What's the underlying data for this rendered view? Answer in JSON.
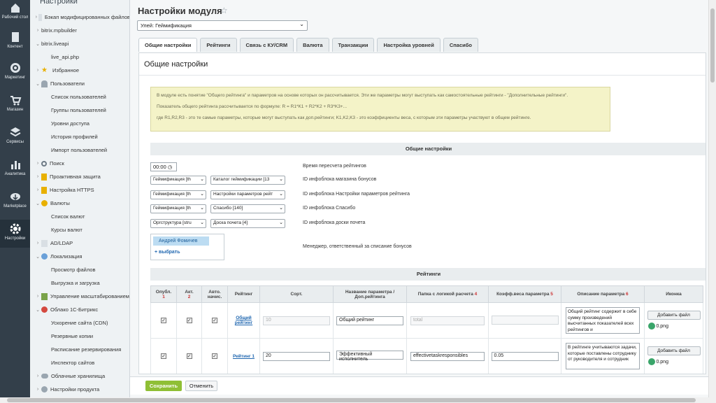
{
  "rail": [
    {
      "label": "Рабочий стол",
      "icon": "house-icon"
    },
    {
      "label": "Контент",
      "icon": "document-icon"
    },
    {
      "label": "Маркетинг",
      "icon": "target-icon"
    },
    {
      "label": "Магазин",
      "icon": "cart-icon"
    },
    {
      "label": "Сервисы",
      "icon": "layers-icon"
    },
    {
      "label": "Аналитика",
      "icon": "bar-chart-icon"
    },
    {
      "label": "Marketplace",
      "icon": "cloud-download-icon"
    },
    {
      "label": "Настройки",
      "icon": "gear-icon"
    }
  ],
  "tree": {
    "header": "Настройки",
    "items": [
      "Бэкап модифицированных файлов",
      "bitrix.mpbuilder",
      "bitrix.liveapi",
      "live_api.php",
      "Избранное",
      "Пользователи",
      "Список пользователей",
      "Группы пользователей",
      "Уровни доступа",
      "История профилей",
      "Импорт пользователей",
      "Поиск",
      "Проактивная защита",
      "Настройка HTTPS",
      "Валюты",
      "Список валют",
      "Курсы валют",
      "AD/LDAP",
      "Локализация",
      "Просмотр файлов",
      "Выгрузка и загрузка",
      "Управление масштабированием",
      "Облако 1С-Битрикс",
      "Ускорение сайта (CDN)",
      "Резервные копии",
      "Расписание резервирования",
      "Инспектор сайтов",
      "Облачные хранилища",
      "Настройки продукта"
    ]
  },
  "page": {
    "title": "Настройки модуля",
    "module_select": "Улей: Геймификация"
  },
  "tabs": [
    "Общие настройки",
    "Рейтинги",
    "Связь с КУ/CRM",
    "Валюта",
    "Транзакции",
    "Настройка уровней",
    "Спасибо"
  ],
  "panel": {
    "title": "Общие настройки"
  },
  "notice": [
    "В модуле есть понятие \"Общего рейтинга\" и параметров на основе которых он рассчитывается. Эти же параметры могут выступать как самостоятельные рейтинги - \"Дополнительные рейтинги\".",
    "Показатель общего рейтинга рассчитывается по формуле: R = R1*K1 + R2*K2 + R3*K3+...",
    "где R1,R2,R3 - это те самые параметры, которые могут выступать как доп.рейтинги; K1,K2,K3 - это коэффициенты веса, с которым эти параметры участвуют в общем рейтинге."
  ],
  "general": {
    "section": "Общие настройки",
    "time": "00:00",
    "time_label": "Время пересчета рейтингов",
    "rows": [
      {
        "left": "Геймификация [th",
        "right": "Каталог геймификации [13",
        "label": "ID инфоблока магазина бонусов"
      },
      {
        "left": "Геймификация [th",
        "right": "Настройки параметров рейт",
        "label": "ID инфоблока Настройки параметров рейтинга"
      },
      {
        "left": "Геймификация [th",
        "right": "Спасибо [140]",
        "label": "ID инфоблока Спасибо"
      },
      {
        "left": "Оргструктура [stru",
        "right": "Доска почета [4]",
        "label": "ID инфоблока доски почета"
      }
    ],
    "manager_chip": "Андрей Фомичев",
    "manager_pick": "+ выбрать",
    "manager_label": "Менеджер, ответственный за списание бонусов"
  },
  "ratings": {
    "section": "Рейтинги",
    "headers": [
      "Опубл.",
      "Акт.",
      "Авто. начис.",
      "Рейтинг",
      "Сорт.",
      "Название параметра / Доп.рейтинга",
      "Папка с логикой расчета",
      "Коэфф.веса параметра",
      "Описание параметра",
      "Иконка"
    ],
    "header_marks": [
      "1",
      "2",
      "",
      "",
      "",
      "",
      "4",
      "5",
      "6",
      ""
    ],
    "add_file": "Добавить файл",
    "rows": [
      {
        "link": "Общий рейтинг",
        "sort": "10",
        "name": "Общий рейтинг",
        "folder": "total",
        "coef": "",
        "desc": "Общий рейтинг содержит в себе сумму произведений высчитанных показателей всех рейтингов и",
        "file": "0.png"
      },
      {
        "link": "Рейтинг 1",
        "sort": "20",
        "name": "Эффективный исполнитель",
        "folder": "effectivetaskresponsibles",
        "coef": "0.05",
        "desc": "В рейтинге учитываются задачи, которые поставлены сотруднику от руководителя и сотрудник",
        "file": "0.png"
      }
    ]
  },
  "footer": {
    "save": "Сохранить",
    "cancel": "Отменить"
  },
  "colors": {
    "rail": "#333f4a",
    "accent": "#8fbf35",
    "notice": "#f4f3c8",
    "link": "#2067b0"
  }
}
